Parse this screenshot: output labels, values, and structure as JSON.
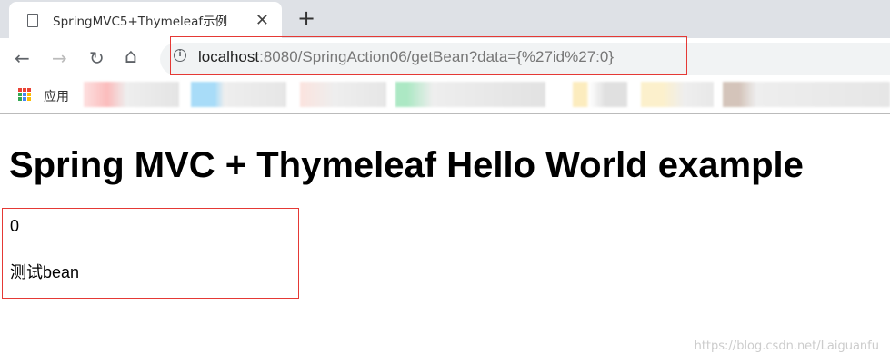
{
  "tab": {
    "title": "SpringMVC5+Thymeleaf示例",
    "close": "✕",
    "new_tab": "+"
  },
  "nav": {
    "back": "←",
    "forward": "→",
    "reload": "↻",
    "home": "⌂"
  },
  "address": {
    "host": "localhost",
    "path": ":8080/SpringAction06/getBean?data={%27id%27:0}"
  },
  "bookmarks": {
    "apps_label": "应用"
  },
  "page": {
    "heading": "Spring MVC + Thymeleaf Hello World example",
    "id": "0",
    "name": "测试bean"
  },
  "watermark": "https://blog.csdn.net/Laiguanfu",
  "colors": {
    "highlight": "#e53935"
  }
}
